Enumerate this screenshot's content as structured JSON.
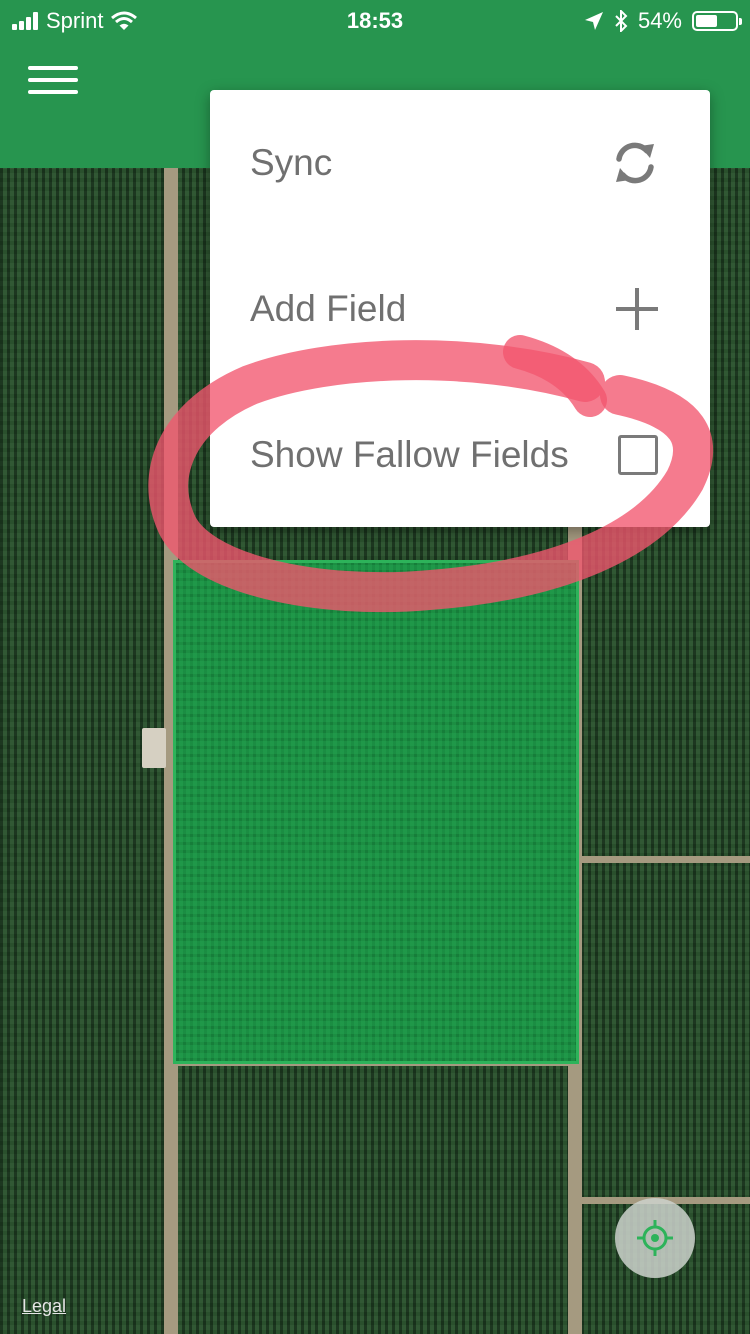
{
  "status_bar": {
    "carrier": "Sprint",
    "time": "18:53",
    "battery_percent": "54%",
    "battery_level": 0.54,
    "icons": [
      "signal-icon",
      "wifi-icon",
      "location-arrow-icon",
      "bluetooth-icon",
      "battery-icon"
    ]
  },
  "app_bar": {
    "color": "#27954f",
    "menu_icon": "hamburger-menu-icon"
  },
  "popup_menu": {
    "items": [
      {
        "label": "Sync",
        "icon": "sync-icon"
      },
      {
        "label": "Add Field",
        "icon": "plus-icon"
      },
      {
        "label": "Show Fallow Fields",
        "icon": "checkbox-icon",
        "checked": false
      }
    ]
  },
  "annotation": {
    "color": "#f2566e",
    "shape": "hand-drawn circle"
  },
  "map": {
    "legal_link": "Legal",
    "locate_icon": "locate-crosshair-icon",
    "selected_field_color": "#2db35a"
  }
}
